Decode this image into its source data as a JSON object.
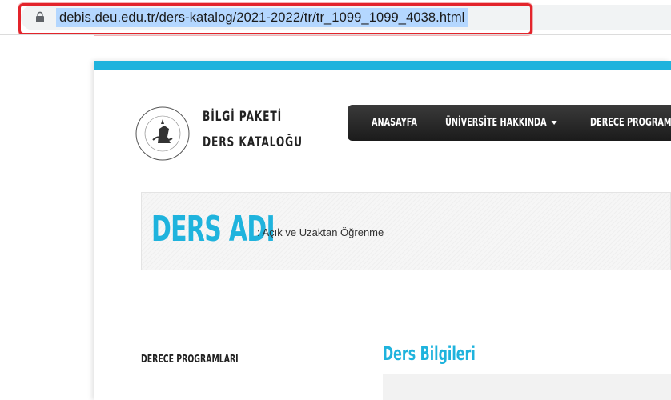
{
  "browser": {
    "url": "debis.deu.edu.tr/ders-katalog/2021-2022/tr/tr_1099_1099_4038.html",
    "lock_icon": "lock-icon"
  },
  "site": {
    "title_line1": "BİLGİ PAKETİ",
    "title_line2": "DERS KATALOĞU",
    "logo_icon": "university-seal-icon"
  },
  "nav": {
    "items": [
      "ANASAYFA",
      "ÜNİVERSİTE HAKKINDA",
      "DERECE PROGRAM"
    ]
  },
  "hero": {
    "title": "DERS ADI",
    "subtitle": ": Açık ve Uzaktan Öğrenme"
  },
  "sidebar": {
    "heading": "DERECE PROGRAMLARI"
  },
  "content": {
    "section_heading": "Ders Bilgileri"
  },
  "colors": {
    "accent": "#1fb3dd",
    "nav_bg": "#222222",
    "highlight_border": "#e3242b",
    "url_selection": "#b4d7ff"
  }
}
